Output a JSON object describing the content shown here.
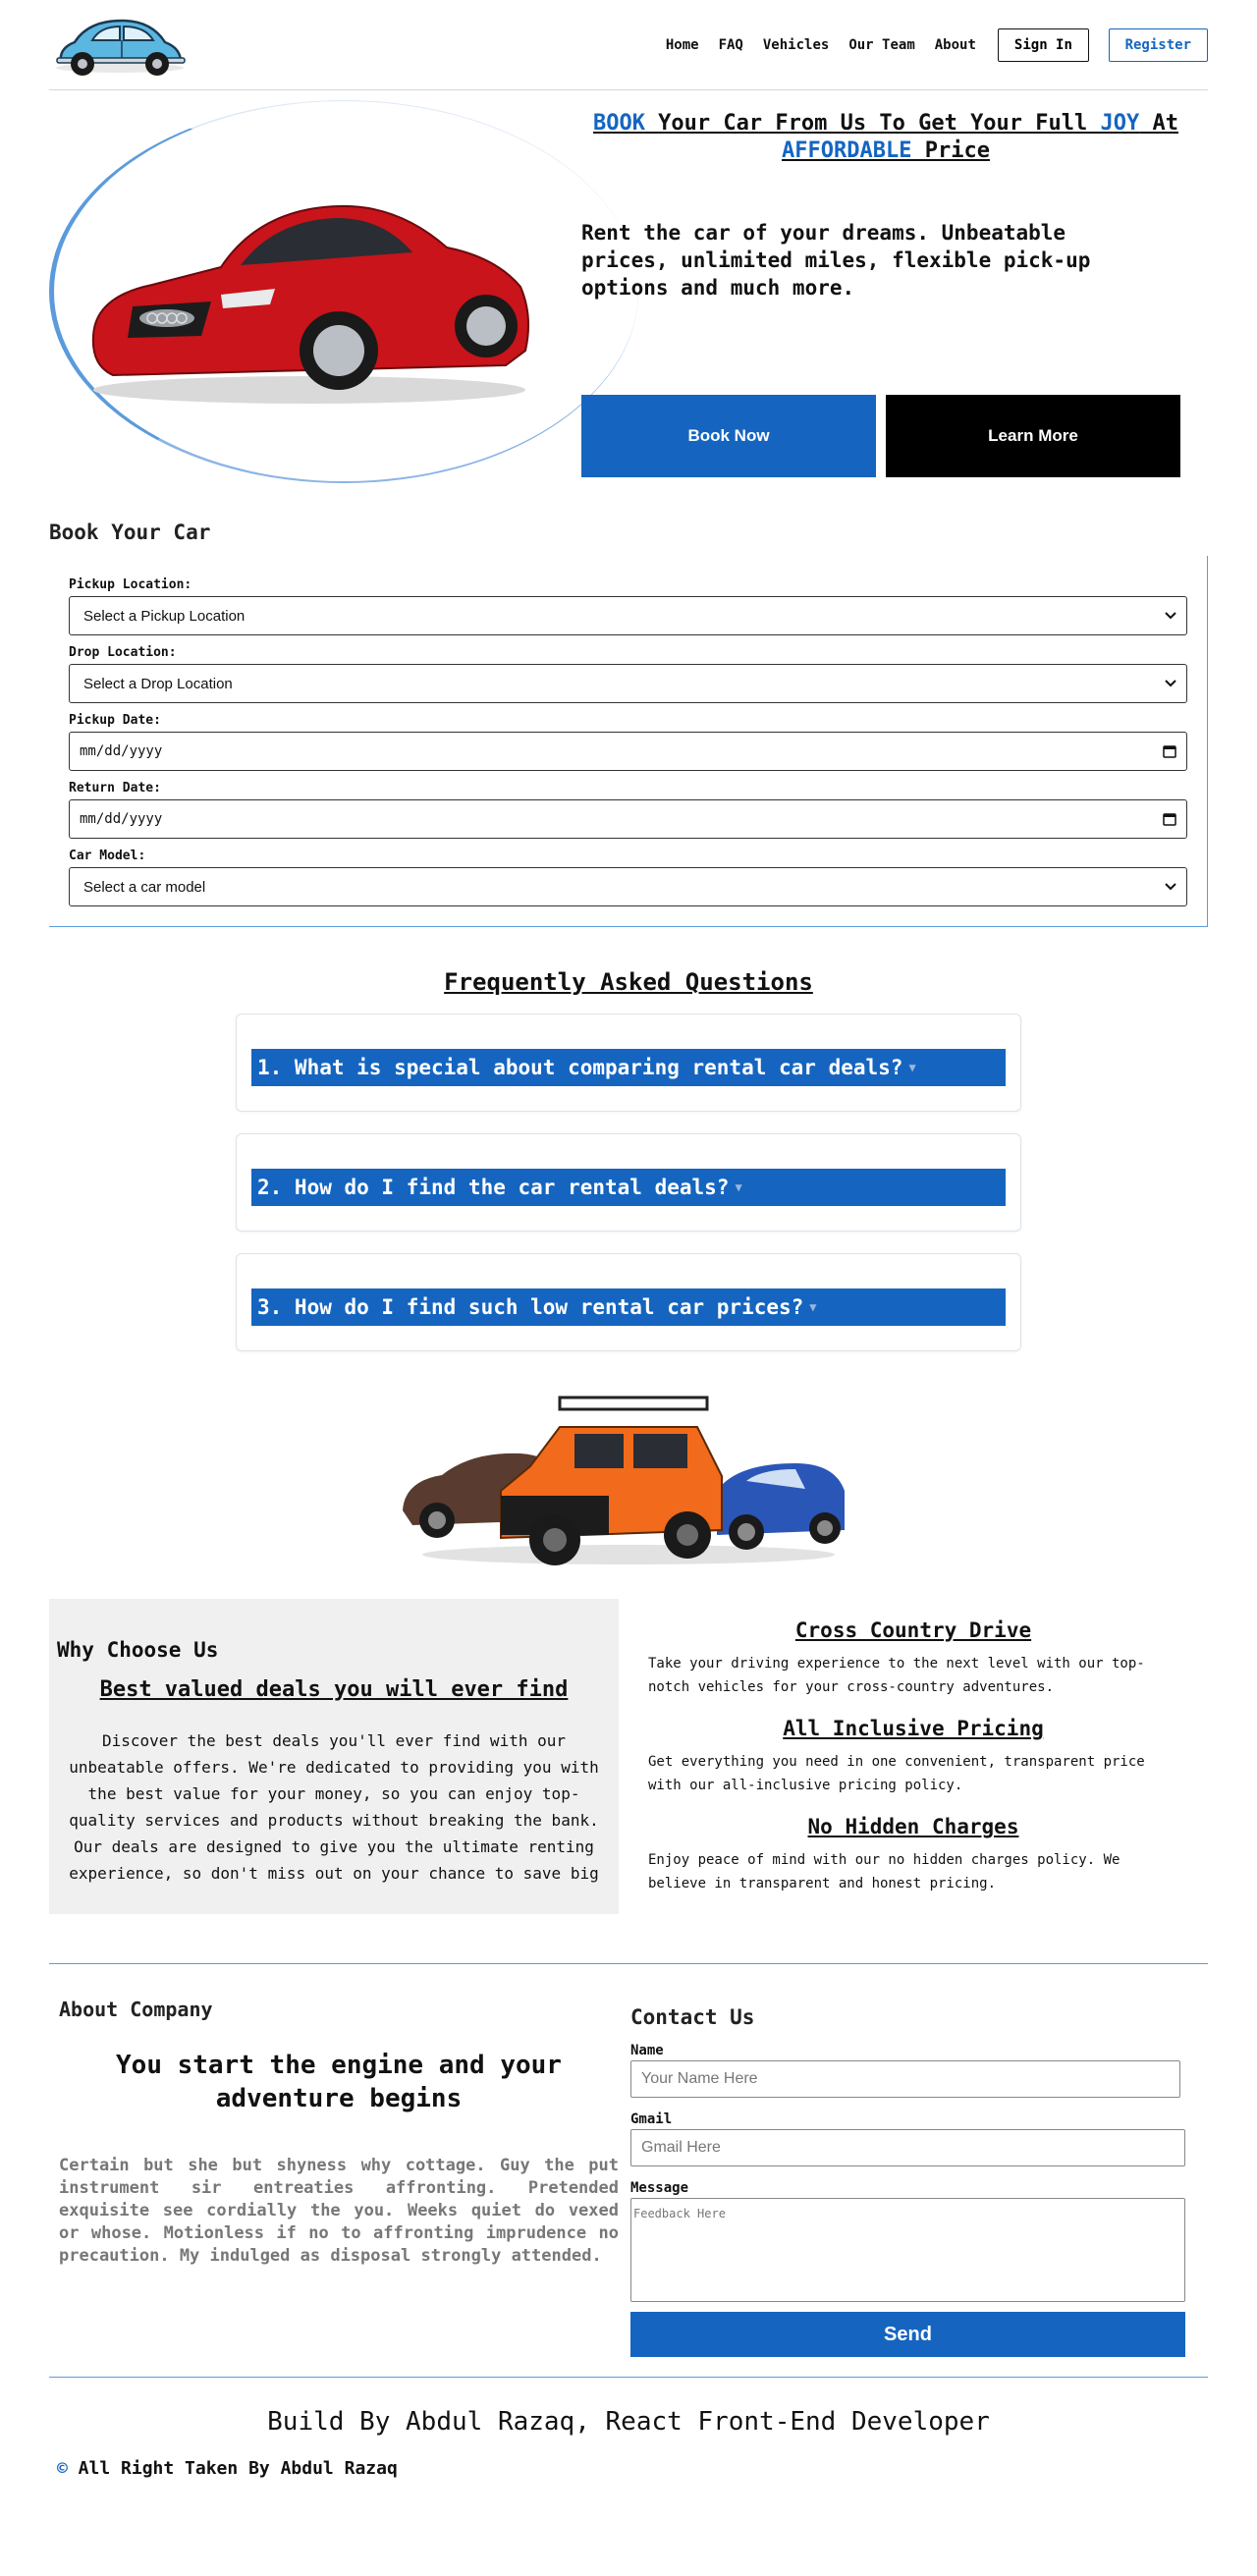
{
  "nav": {
    "links": [
      "Home",
      "FAQ",
      "Vehicles",
      "Our Team",
      "About"
    ],
    "signin": "Sign In",
    "register": "Register"
  },
  "hero": {
    "title_parts": [
      "BOOK",
      " Your Car From Us To Get Your Full ",
      "JOY",
      " At ",
      "AFFORDABLE",
      " Price"
    ],
    "description": "Rent the car of your dreams. Unbeatable prices, unlimited miles, flexible pick-up options and much more.",
    "book_now": "Book Now",
    "learn_more": "Learn More",
    "accent_color": "#1565c0"
  },
  "booking": {
    "title": "Book Your Car",
    "fields": {
      "pickup_location": {
        "label": "Pickup Location:",
        "value": "Select a Pickup Location"
      },
      "drop_location": {
        "label": "Drop Location:",
        "value": "Select a Drop Location"
      },
      "pickup_date": {
        "label": "Pickup Date:",
        "placeholder": "mm/dd/yyyy"
      },
      "return_date": {
        "label": "Return Date:",
        "placeholder": "mm/dd/yyyy"
      },
      "car_model": {
        "label": "Car Model:",
        "value": "Select a car model"
      }
    }
  },
  "faq": {
    "title": "Frequently Asked Questions",
    "questions": [
      "1. What is special about comparing rental car deals?",
      "2. How do I find the car rental deals?",
      "3. How do I find such low rental car prices?"
    ]
  },
  "why": {
    "title": "Why Choose Us",
    "subtitle": "Best valued deals you will ever find",
    "body": "Discover the best deals you'll ever find with our unbeatable offers. We're dedicated to providing you with the best value for your money, so you can enjoy top-quality services and products without breaking the bank. Our deals are designed to give you the ultimate renting experience, so don't miss out on your chance to save big",
    "features": [
      {
        "title": "Cross Country Drive",
        "text": "Take your driving experience to the next level with our top-notch vehicles for your cross-country adventures."
      },
      {
        "title": "All Inclusive Pricing",
        "text": "Get everything you need in one convenient, transparent price with our all-inclusive pricing policy."
      },
      {
        "title": "No Hidden Charges",
        "text": "Enjoy peace of mind with our no hidden charges policy. We believe in transparent and honest pricing."
      }
    ]
  },
  "about": {
    "title": "About Company",
    "headline": "You start the engine and your adventure begins",
    "body": "Certain but she but shyness why cottage. Guy the put instrument sir entreaties affronting. Pretended exquisite see cordially the you. Weeks quiet do vexed or whose. Motionless if no to affronting imprudence no precaution. My indulged as disposal strongly attended."
  },
  "contact": {
    "title": "Contact Us",
    "name_label": "Name",
    "name_placeholder": "Your Name Here",
    "gmail_label": "Gmail",
    "gmail_placeholder": "Gmail Here",
    "message_label": "Message",
    "message_placeholder": "Feedback Here",
    "send": "Send"
  },
  "footer": {
    "title": "Build By Abdul Razaq, React Front-End Developer",
    "copyright_symbol": "©",
    "copyright": " All Right Taken By Abdul Razaq"
  }
}
